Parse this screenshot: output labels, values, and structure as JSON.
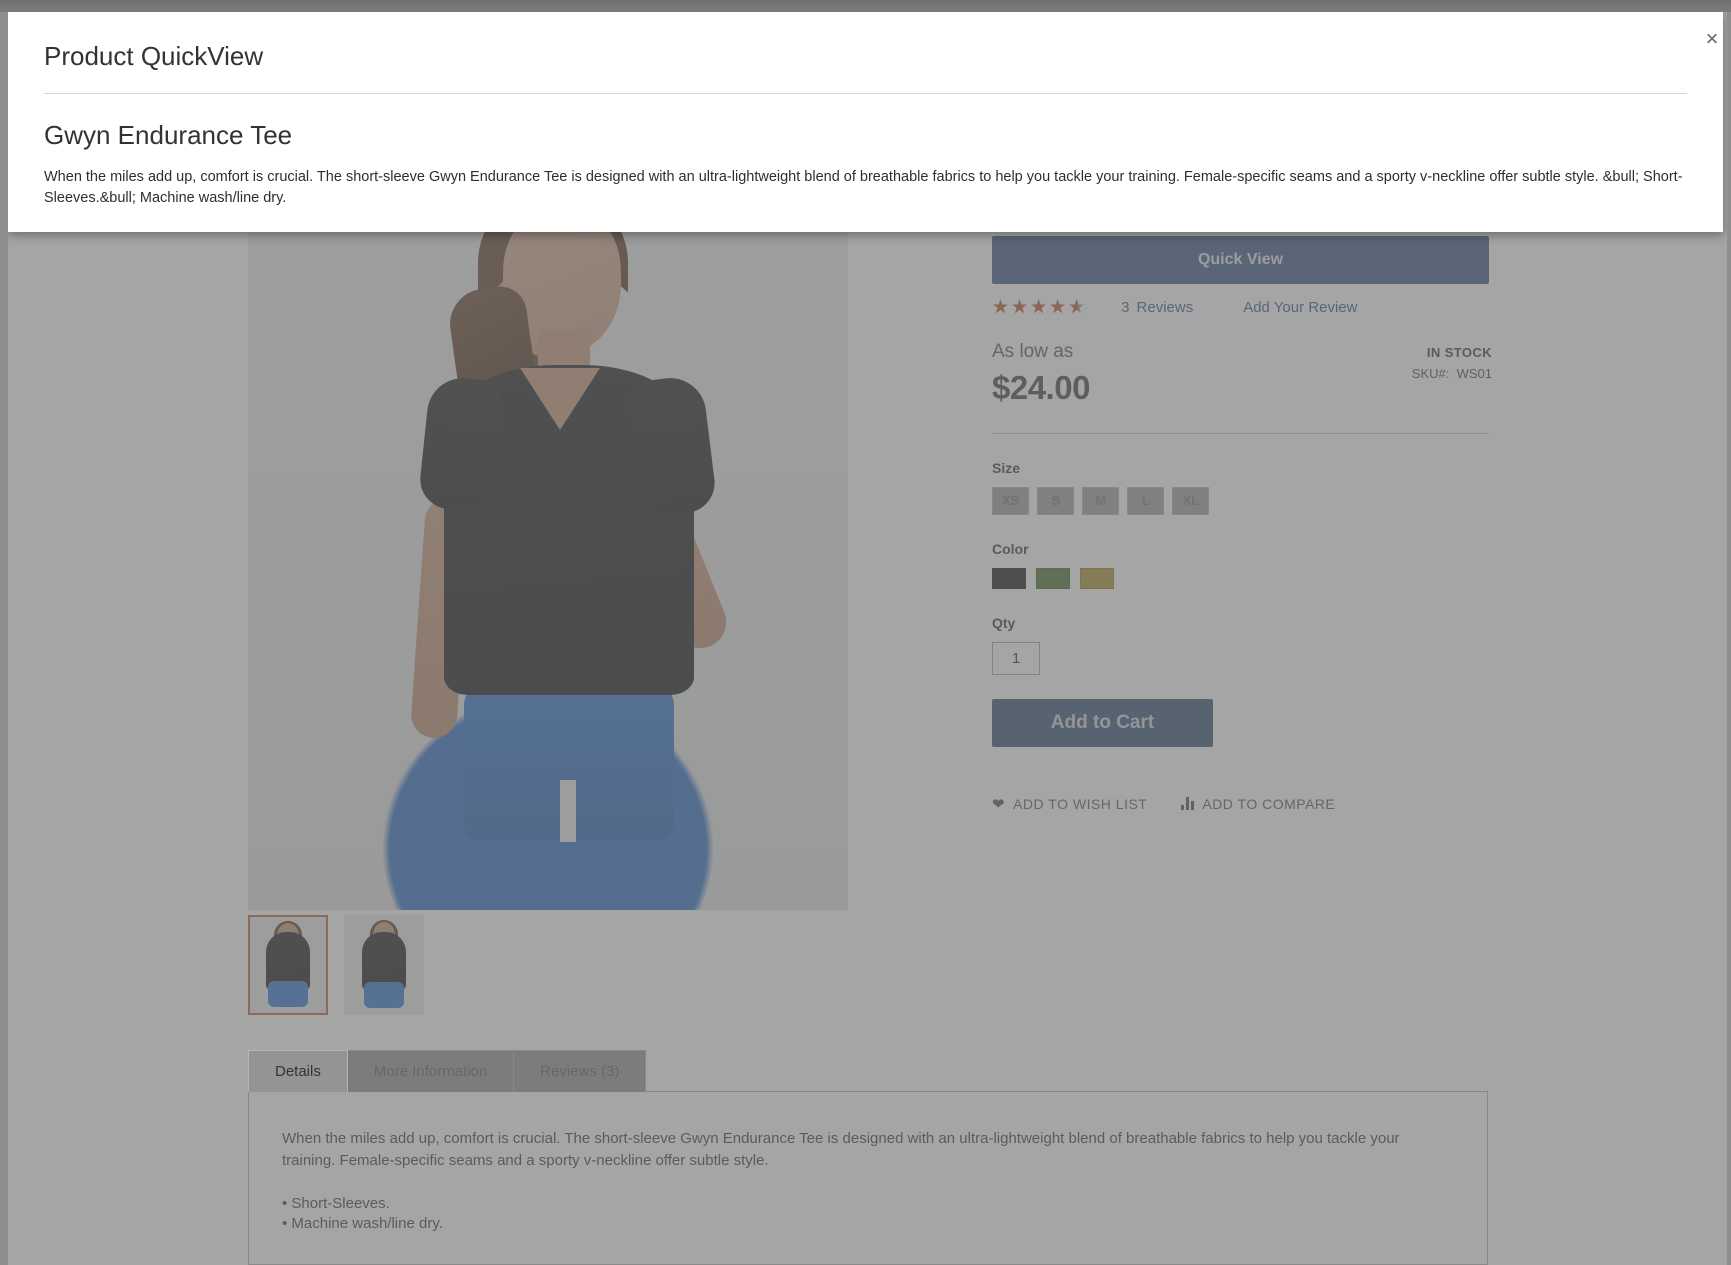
{
  "modal": {
    "title": "Product QuickView",
    "close_label": "×",
    "product_name": "Gwyn Endurance Tee",
    "description": "When the miles add up, comfort is crucial. The short-sleeve Gwyn Endurance Tee is designed with an ultra-lightweight blend of breathable fabrics to help you tackle your training. Female-specific seams and a sporty v-neckline offer subtle style. &bull; Short-Sleeves.&bull; Machine wash/line dry."
  },
  "product": {
    "title": "Gwyn Endurance Tee",
    "quick_view_label": "Quick View",
    "rating_stars": "★★★★★",
    "rating_value": 4.5,
    "rating_max": 5,
    "reviews_count": "3",
    "reviews_label": "Reviews",
    "add_review_label": "Add Your Review",
    "as_low_as_label": "As low as",
    "price": "$24.00",
    "stock_status": "IN STOCK",
    "sku_label": "SKU#:",
    "sku_value": "WS01",
    "size_label": "Size",
    "sizes": [
      "XS",
      "S",
      "M",
      "L",
      "XL"
    ],
    "color_label": "Color",
    "colors": [
      {
        "name": "black",
        "hex": "#1c1c1e"
      },
      {
        "name": "green",
        "hex": "#4b7330"
      },
      {
        "name": "yellow",
        "hex": "#a89234"
      }
    ],
    "qty_label": "Qty",
    "qty_value": "1",
    "add_to_cart_label": "Add to Cart",
    "wish_list_label": "ADD TO WISH LIST",
    "compare_label": "ADD TO COMPARE",
    "accent_blue": "#3b5b87",
    "accent_star": "#c2552f",
    "thumb_active_border": "#c7603a"
  },
  "tabs": [
    {
      "label": "Details",
      "active": true
    },
    {
      "label": "More Information",
      "active": false
    },
    {
      "label": "Reviews (3)",
      "active": false
    }
  ],
  "details_panel": {
    "paragraph": "When the miles add up, comfort is crucial. The short-sleeve Gwyn Endurance Tee is designed with an ultra-lightweight blend of breathable fabrics to help you tackle your training. Female-specific seams and a sporty v-neckline offer subtle style.",
    "bullets": [
      "Short-Sleeves.",
      "Machine wash/line dry."
    ]
  }
}
